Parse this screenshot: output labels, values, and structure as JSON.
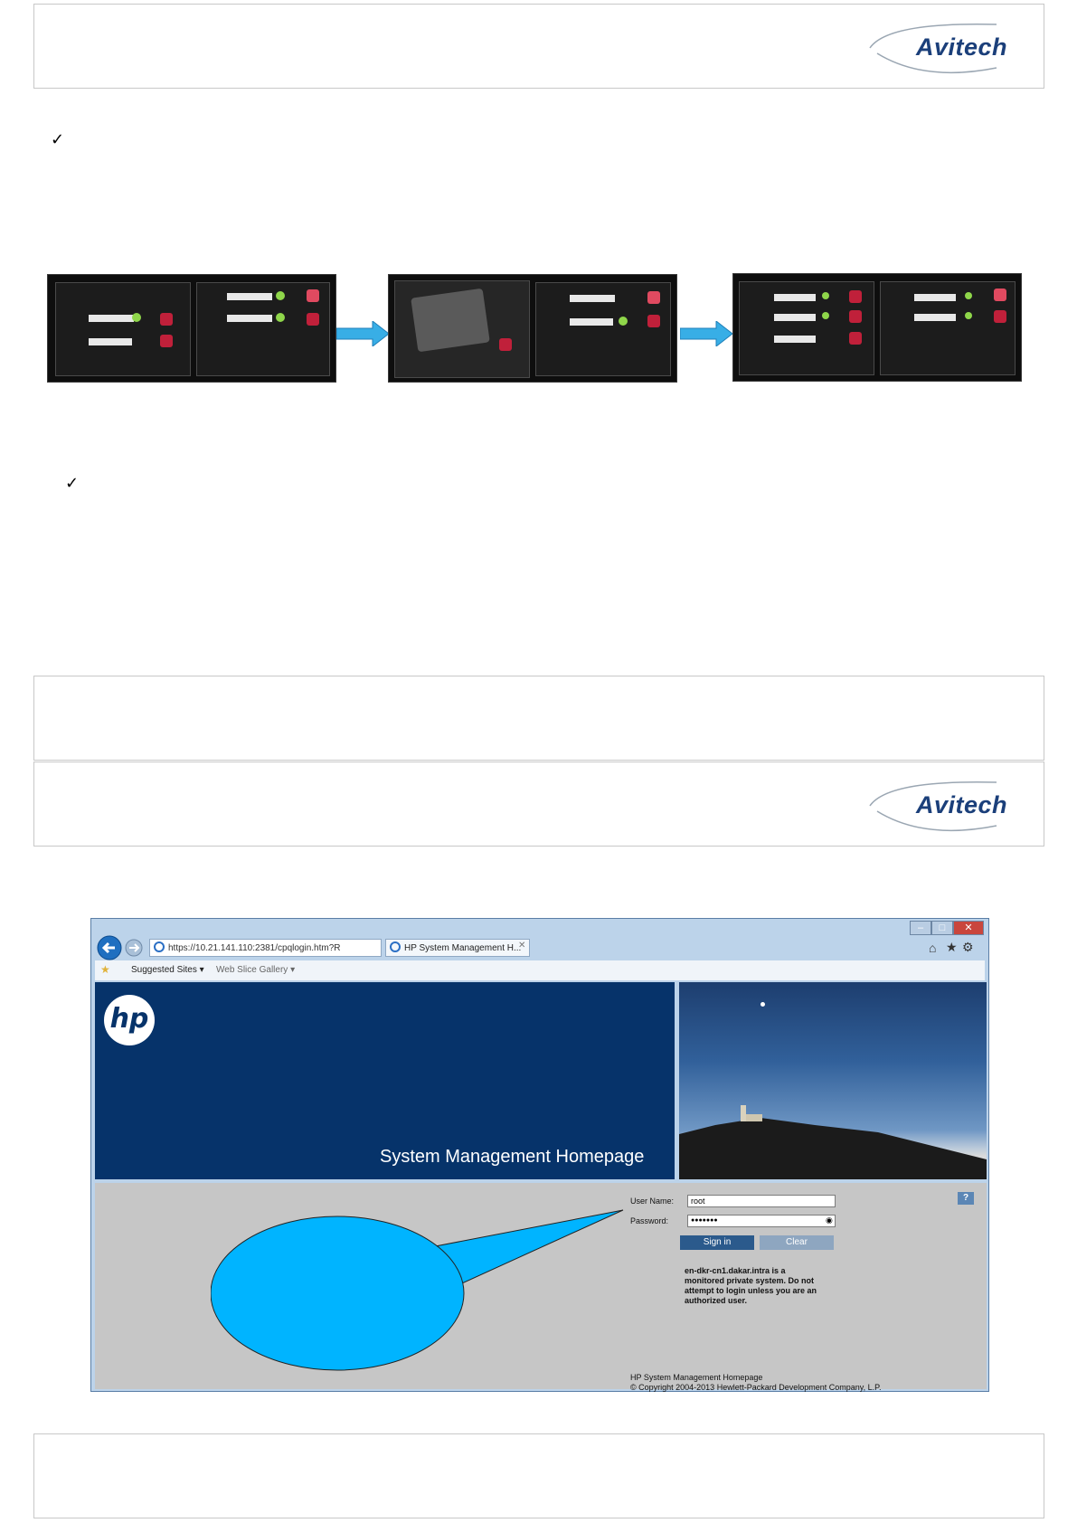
{
  "header": {
    "logo_text": "Avitech"
  },
  "section1": {
    "check": "✓"
  },
  "section2": {
    "check": "✓"
  },
  "header2": {
    "logo_text": "Avitech"
  },
  "browser": {
    "address": "https://10.21.141.110:2381/cpqlogin.htm?R",
    "tab_title": "HP System Management H...",
    "favorites": [
      "Suggested Sites ▾",
      "Web Slice Gallery ▾"
    ],
    "hp_logo": "hp",
    "banner_title": "System Management Homepage",
    "help": "?",
    "login": {
      "username_label": "User Name:",
      "username_value": "root",
      "password_label": "Password:",
      "password_value": "●●●●●●●",
      "sign_in": "Sign in",
      "clear": "Clear",
      "notice": [
        "en-dkr-cn1.dakar.intra is a",
        "monitored private system. Do not",
        "attempt to login unless you are an",
        "authorized user."
      ]
    },
    "footer": [
      "HP System Management Homepage",
      "© Copyright 2004-2013 Hewlett-Packard Development Company, L.P."
    ]
  },
  "colors": {
    "callout": "#00b4ff",
    "logo": "#1b3f7a",
    "arrow": "#38aee6"
  }
}
